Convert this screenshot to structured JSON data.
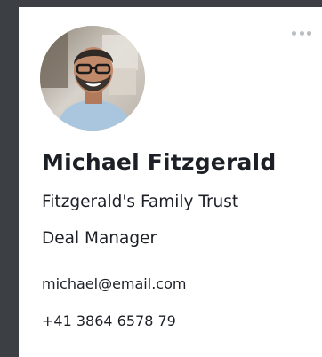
{
  "contact": {
    "name": "Michael Fitzgerald",
    "company": "Fitzgerald's Family Trust",
    "role": "Deal Manager",
    "email": "michael@email.com",
    "phone": "+41 3864 6578 79"
  },
  "icons": {
    "menu": "more-horizontal-icon"
  }
}
